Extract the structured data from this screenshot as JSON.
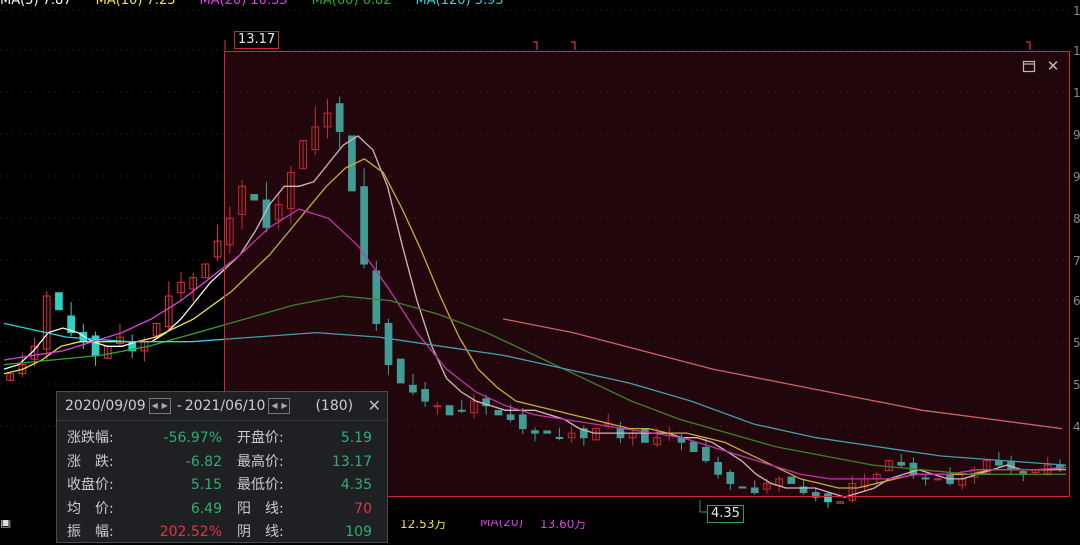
{
  "ma_strip": {
    "items": [
      {
        "label": "MA(5)",
        "value": "7.87",
        "color": "#f5f5f5"
      },
      {
        "label": "MA(10)",
        "value": "7.25",
        "color": "#f0e442"
      },
      {
        "label": "MA(20)",
        "value": "10.35",
        "color": "#e040e0"
      },
      {
        "label": "MA(60)",
        "value": "6.82",
        "color": "#2fa82f"
      },
      {
        "label": "MA(120)",
        "value": "5.95",
        "color": "#33d0e0"
      }
    ]
  },
  "range_box": {
    "high_tag": "13.17",
    "low_tag": "4.35",
    "restore_icon": "restore-window-icon",
    "close_icon": "close-icon"
  },
  "stats_panel": {
    "date_start": "2020/09/09",
    "date_end": "2021/06/10",
    "separator": "-",
    "count": "(180)",
    "rows": [
      {
        "l1": "涨跌幅:",
        "v1": "-56.97%",
        "c1": "green",
        "l2": "开盘价:",
        "v2": "5.19",
        "c2": "green"
      },
      {
        "l1": "涨　跌:",
        "v1": "-6.82",
        "c1": "green",
        "l2": "最高价:",
        "v2": "13.17",
        "c2": "green"
      },
      {
        "l1": "收盘价:",
        "v1": "5.15",
        "c1": "green",
        "l2": "最低价:",
        "v2": "4.35",
        "c2": "green"
      },
      {
        "l1": "均　价:",
        "v1": "6.49",
        "c1": "green",
        "l2": "阳　线:",
        "v2": "70",
        "c2": "red"
      },
      {
        "l1": "振　幅:",
        "v1": "202.52%",
        "c1": "red",
        "l2": "阴　线:",
        "v2": "109",
        "c2": "green"
      }
    ]
  },
  "right_axis_ticks": [
    "1",
    "1",
    "1",
    "9",
    "9",
    "8",
    "7",
    "6",
    "5",
    "5",
    "4"
  ],
  "bottom_strip": {
    "a": "12.53万",
    "b": "MA(20)",
    "c": "13.60万"
  },
  "colors": {
    "up": "#e8313f",
    "down": "#2fd0c0",
    "ma5": "#f5f5f5",
    "ma10": "#f0e442",
    "ma20": "#e040e0",
    "ma60": "#2fa82f",
    "ma120": "#33d0e0",
    "ma250": "#f08080"
  },
  "chart_data": {
    "type": "candlestick",
    "title": "",
    "price_range": [
      4.0,
      14.5
    ],
    "selection": {
      "start": "2020/09/09",
      "end": "2021/06/10",
      "high": 13.17,
      "low": 4.35
    },
    "candles_summary": {
      "open": 5.19,
      "high": 13.17,
      "low": 4.35,
      "close": 5.15,
      "change": -6.82,
      "change_pct": -56.97,
      "avg": 6.49,
      "up_count": 70,
      "down_count": 109,
      "amplitude_pct": 202.52
    },
    "close_series": [
      7.2,
      7.4,
      7.8,
      8.9,
      8.6,
      8.1,
      7.9,
      7.6,
      7.8,
      8.0,
      7.7,
      7.9,
      8.3,
      8.9,
      9.2,
      9.3,
      9.6,
      10.1,
      10.6,
      11.3,
      11.0,
      10.4,
      10.9,
      11.6,
      12.3,
      12.6,
      12.9,
      12.5,
      11.2,
      9.6,
      8.3,
      7.4,
      7.0,
      6.8,
      6.6,
      6.5,
      6.3,
      6.4,
      6.6,
      6.5,
      6.3,
      6.2,
      6.0,
      5.9,
      5.9,
      5.8,
      5.9,
      5.8,
      6.0,
      6.1,
      5.8,
      5.9,
      5.7,
      5.8,
      5.9,
      5.7,
      5.5,
      5.3,
      5.0,
      4.8,
      4.7,
      4.6,
      4.8,
      4.9,
      4.8,
      4.6,
      4.5,
      4.4,
      4.4,
      4.8,
      4.9,
      5.0,
      5.3,
      5.2,
      5.0,
      4.9,
      4.9,
      4.8,
      4.9,
      5.1,
      5.3,
      5.2,
      5.1,
      5.0,
      5.1,
      5.2,
      5.15
    ],
    "ma_series": [
      {
        "name": "MA(5)",
        "values": [
          7.3,
          7.4,
          7.7,
          8.1,
          8.2,
          8.1,
          7.9,
          7.8,
          7.8,
          7.9,
          7.9,
          8.1,
          8.4,
          8.8,
          9.2,
          9.5,
          9.8,
          10.3,
          10.9,
          11.3,
          11.3,
          11.4,
          11.8,
          12.2,
          12.4,
          12.1,
          11.3,
          10.0,
          8.8,
          7.8,
          7.1,
          6.8,
          6.6,
          6.5,
          6.4,
          6.4,
          6.4,
          6.3,
          6.2,
          6.0,
          5.9,
          5.9,
          5.9,
          5.9,
          5.9,
          5.9,
          5.8,
          5.8,
          5.7,
          5.5,
          5.3,
          5.0,
          4.8,
          4.7,
          4.7,
          4.7,
          4.6,
          4.5,
          4.6,
          4.7,
          4.9,
          5.0,
          5.1,
          5.0,
          4.9,
          4.9,
          5.0,
          5.1,
          5.2,
          5.1,
          5.1,
          5.1,
          5.15
        ]
      },
      {
        "name": "MA(10)",
        "values": [
          7.2,
          7.3,
          7.5,
          7.8,
          7.9,
          7.9,
          7.9,
          7.9,
          8.0,
          8.2,
          8.4,
          8.7,
          9.0,
          9.4,
          9.8,
          10.3,
          10.8,
          11.3,
          11.7,
          11.9,
          11.6,
          10.8,
          9.9,
          8.9,
          8.0,
          7.3,
          6.9,
          6.6,
          6.5,
          6.4,
          6.3,
          6.2,
          6.1,
          6.0,
          6.0,
          5.9,
          5.9,
          5.8,
          5.7,
          5.5,
          5.3,
          5.1,
          4.9,
          4.8,
          4.7,
          4.7,
          4.8,
          4.9,
          5.0,
          5.0,
          5.0,
          5.0,
          5.1,
          5.1,
          5.1,
          5.1,
          5.1
        ]
      },
      {
        "name": "MA(20)",
        "values": [
          7.5,
          7.6,
          7.7,
          7.9,
          8.1,
          8.4,
          8.8,
          9.3,
          9.8,
          10.4,
          10.8,
          10.6,
          10.0,
          9.1,
          8.1,
          7.3,
          6.8,
          6.5,
          6.3,
          6.2,
          6.1,
          6.0,
          5.9,
          5.8,
          5.6,
          5.4,
          5.2,
          5.0,
          4.9,
          4.9,
          4.9,
          5.0,
          5.0,
          5.1,
          5.1,
          5.1,
          5.15
        ]
      },
      {
        "name": "MA(60)",
        "values": [
          7.4,
          7.5,
          7.6,
          7.8,
          8.1,
          8.4,
          8.7,
          8.9,
          8.8,
          8.5,
          8.1,
          7.6,
          7.1,
          6.6,
          6.2,
          5.9,
          5.6,
          5.4,
          5.2,
          5.1,
          5.0,
          5.0,
          5.0
        ]
      },
      {
        "name": "MA(120)",
        "values": [
          8.3,
          8.0,
          7.9,
          7.9,
          8.0,
          8.1,
          8.0,
          7.8,
          7.6,
          7.3,
          7.0,
          6.6,
          6.1,
          5.8,
          5.6,
          5.4,
          5.3,
          5.2
        ]
      },
      {
        "name": "MA(250)",
        "values": [
          8.4,
          8.1,
          7.7,
          7.3,
          7.0,
          6.7,
          6.4,
          6.2,
          6.0
        ]
      }
    ]
  }
}
